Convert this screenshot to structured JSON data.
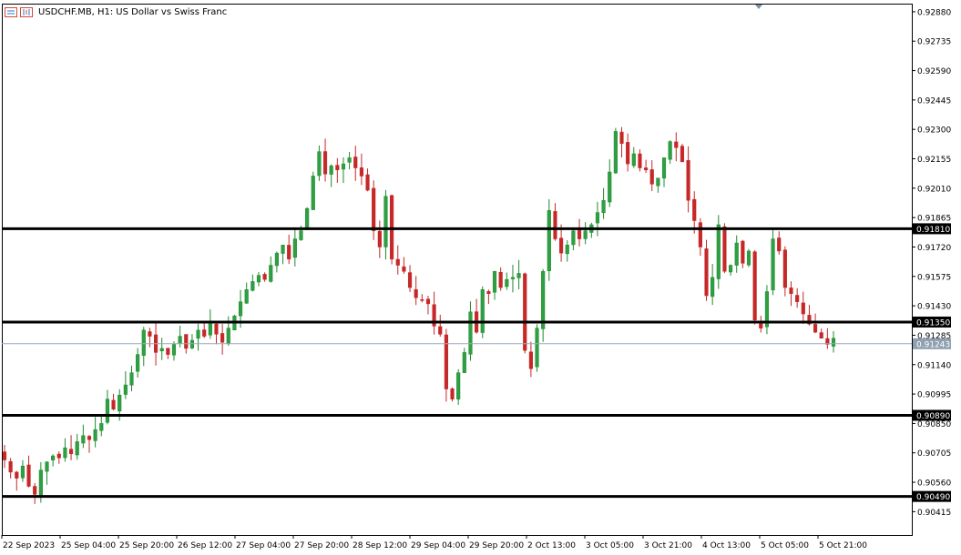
{
  "header": {
    "symbol": "USDCHF.MB, H1:",
    "description": "US Dollar vs Swiss Franc",
    "icons": [
      "chart-window-icon",
      "bars-icon"
    ]
  },
  "colors": {
    "bull": "#26a69a",
    "bull_fill": "#2e9e3e",
    "bear": "#d32f2f",
    "grid": "#000000",
    "level_line": "#000000",
    "price_line": "#9aa9b8",
    "current_label_bg": "#8fa0b0"
  },
  "chart_data": {
    "type": "candlestick",
    "title": "",
    "xlabel": "",
    "ylabel": "",
    "ylim": [
      0.903,
      0.9292
    ],
    "price_ticks": [
      "0.92880",
      "0.92735",
      "0.92590",
      "0.92445",
      "0.92300",
      "0.92155",
      "0.92010",
      "0.91865",
      "0.91720",
      "0.91575",
      "0.91430",
      "0.91285",
      "0.91140",
      "0.90995",
      "0.90850",
      "0.90705",
      "0.90560",
      "0.90415"
    ],
    "time_ticks": [
      "22 Sep 2023",
      "25 Sep 04:00",
      "25 Sep 20:00",
      "26 Sep 12:00",
      "27 Sep 04:00",
      "27 Sep 20:00",
      "28 Sep 12:00",
      "29 Sep 04:00",
      "29 Sep 20:00",
      "2 Oct 13:00",
      "3 Oct 05:00",
      "3 Oct 21:00",
      "4 Oct 13:00",
      "5 Oct 05:00",
      "5 Oct 21:00"
    ],
    "levels": [
      {
        "price": 0.9181,
        "label": "0.91810"
      },
      {
        "price": 0.9135,
        "label": "0.91350"
      },
      {
        "price": 0.9089,
        "label": "0.90890"
      },
      {
        "price": 0.9049,
        "label": "0.90490"
      }
    ],
    "current_price": {
      "price": 0.91243,
      "label": "0.91243"
    },
    "candles_close_path": [
      0.9067,
      0.9061,
      0.9058,
      0.9064,
      0.9054,
      0.905,
      0.9062,
      0.9066,
      0.9069,
      0.9068,
      0.9073,
      0.907,
      0.9076,
      0.9079,
      0.9077,
      0.9082,
      0.9085,
      0.9097,
      0.9092,
      0.9099,
      0.9104,
      0.911,
      0.9119,
      0.9131,
      0.9128,
      0.912,
      0.9122,
      0.9119,
      0.9124,
      0.9128,
      0.9122,
      0.9126,
      0.9131,
      0.9128,
      0.9135,
      0.9129,
      0.9125,
      0.9132,
      0.9138,
      0.9145,
      0.9151,
      0.9155,
      0.9158,
      0.9156,
      0.9163,
      0.9169,
      0.9173,
      0.9166,
      0.9176,
      0.918,
      0.9191,
      0.9207,
      0.9219,
      0.9208,
      0.9212,
      0.921,
      0.9213,
      0.9216,
      0.9211,
      0.9207,
      0.92,
      0.918,
      0.9172,
      0.9197,
      0.9166,
      0.9163,
      0.916,
      0.9152,
      0.9147,
      0.9146,
      0.9144,
      0.9133,
      0.9129,
      0.9102,
      0.9097,
      0.911,
      0.912,
      0.914,
      0.913,
      0.9151,
      0.9149,
      0.916,
      0.9152,
      0.9156,
      0.9157,
      0.9159,
      0.9121,
      0.9112,
      0.9132,
      0.916,
      0.919,
      0.9176,
      0.9169,
      0.9173,
      0.918,
      0.9176,
      0.918,
      0.9183,
      0.9189,
      0.9195,
      0.9209,
      0.9229,
      0.9223,
      0.9213,
      0.9218,
      0.9211,
      0.921,
      0.9203,
      0.9206,
      0.9216,
      0.9224,
      0.9221,
      0.9214,
      0.9195,
      0.9185,
      0.9172,
      0.9148,
      0.9157,
      0.9183,
      0.916,
      0.9163,
      0.9174,
      0.9164,
      0.917,
      0.9136,
      0.9132,
      0.915,
      0.9176,
      0.917,
      0.9152,
      0.9149,
      0.9145,
      0.9139,
      0.9134,
      0.913,
      0.9127,
      0.9124,
      0.9127
    ]
  }
}
